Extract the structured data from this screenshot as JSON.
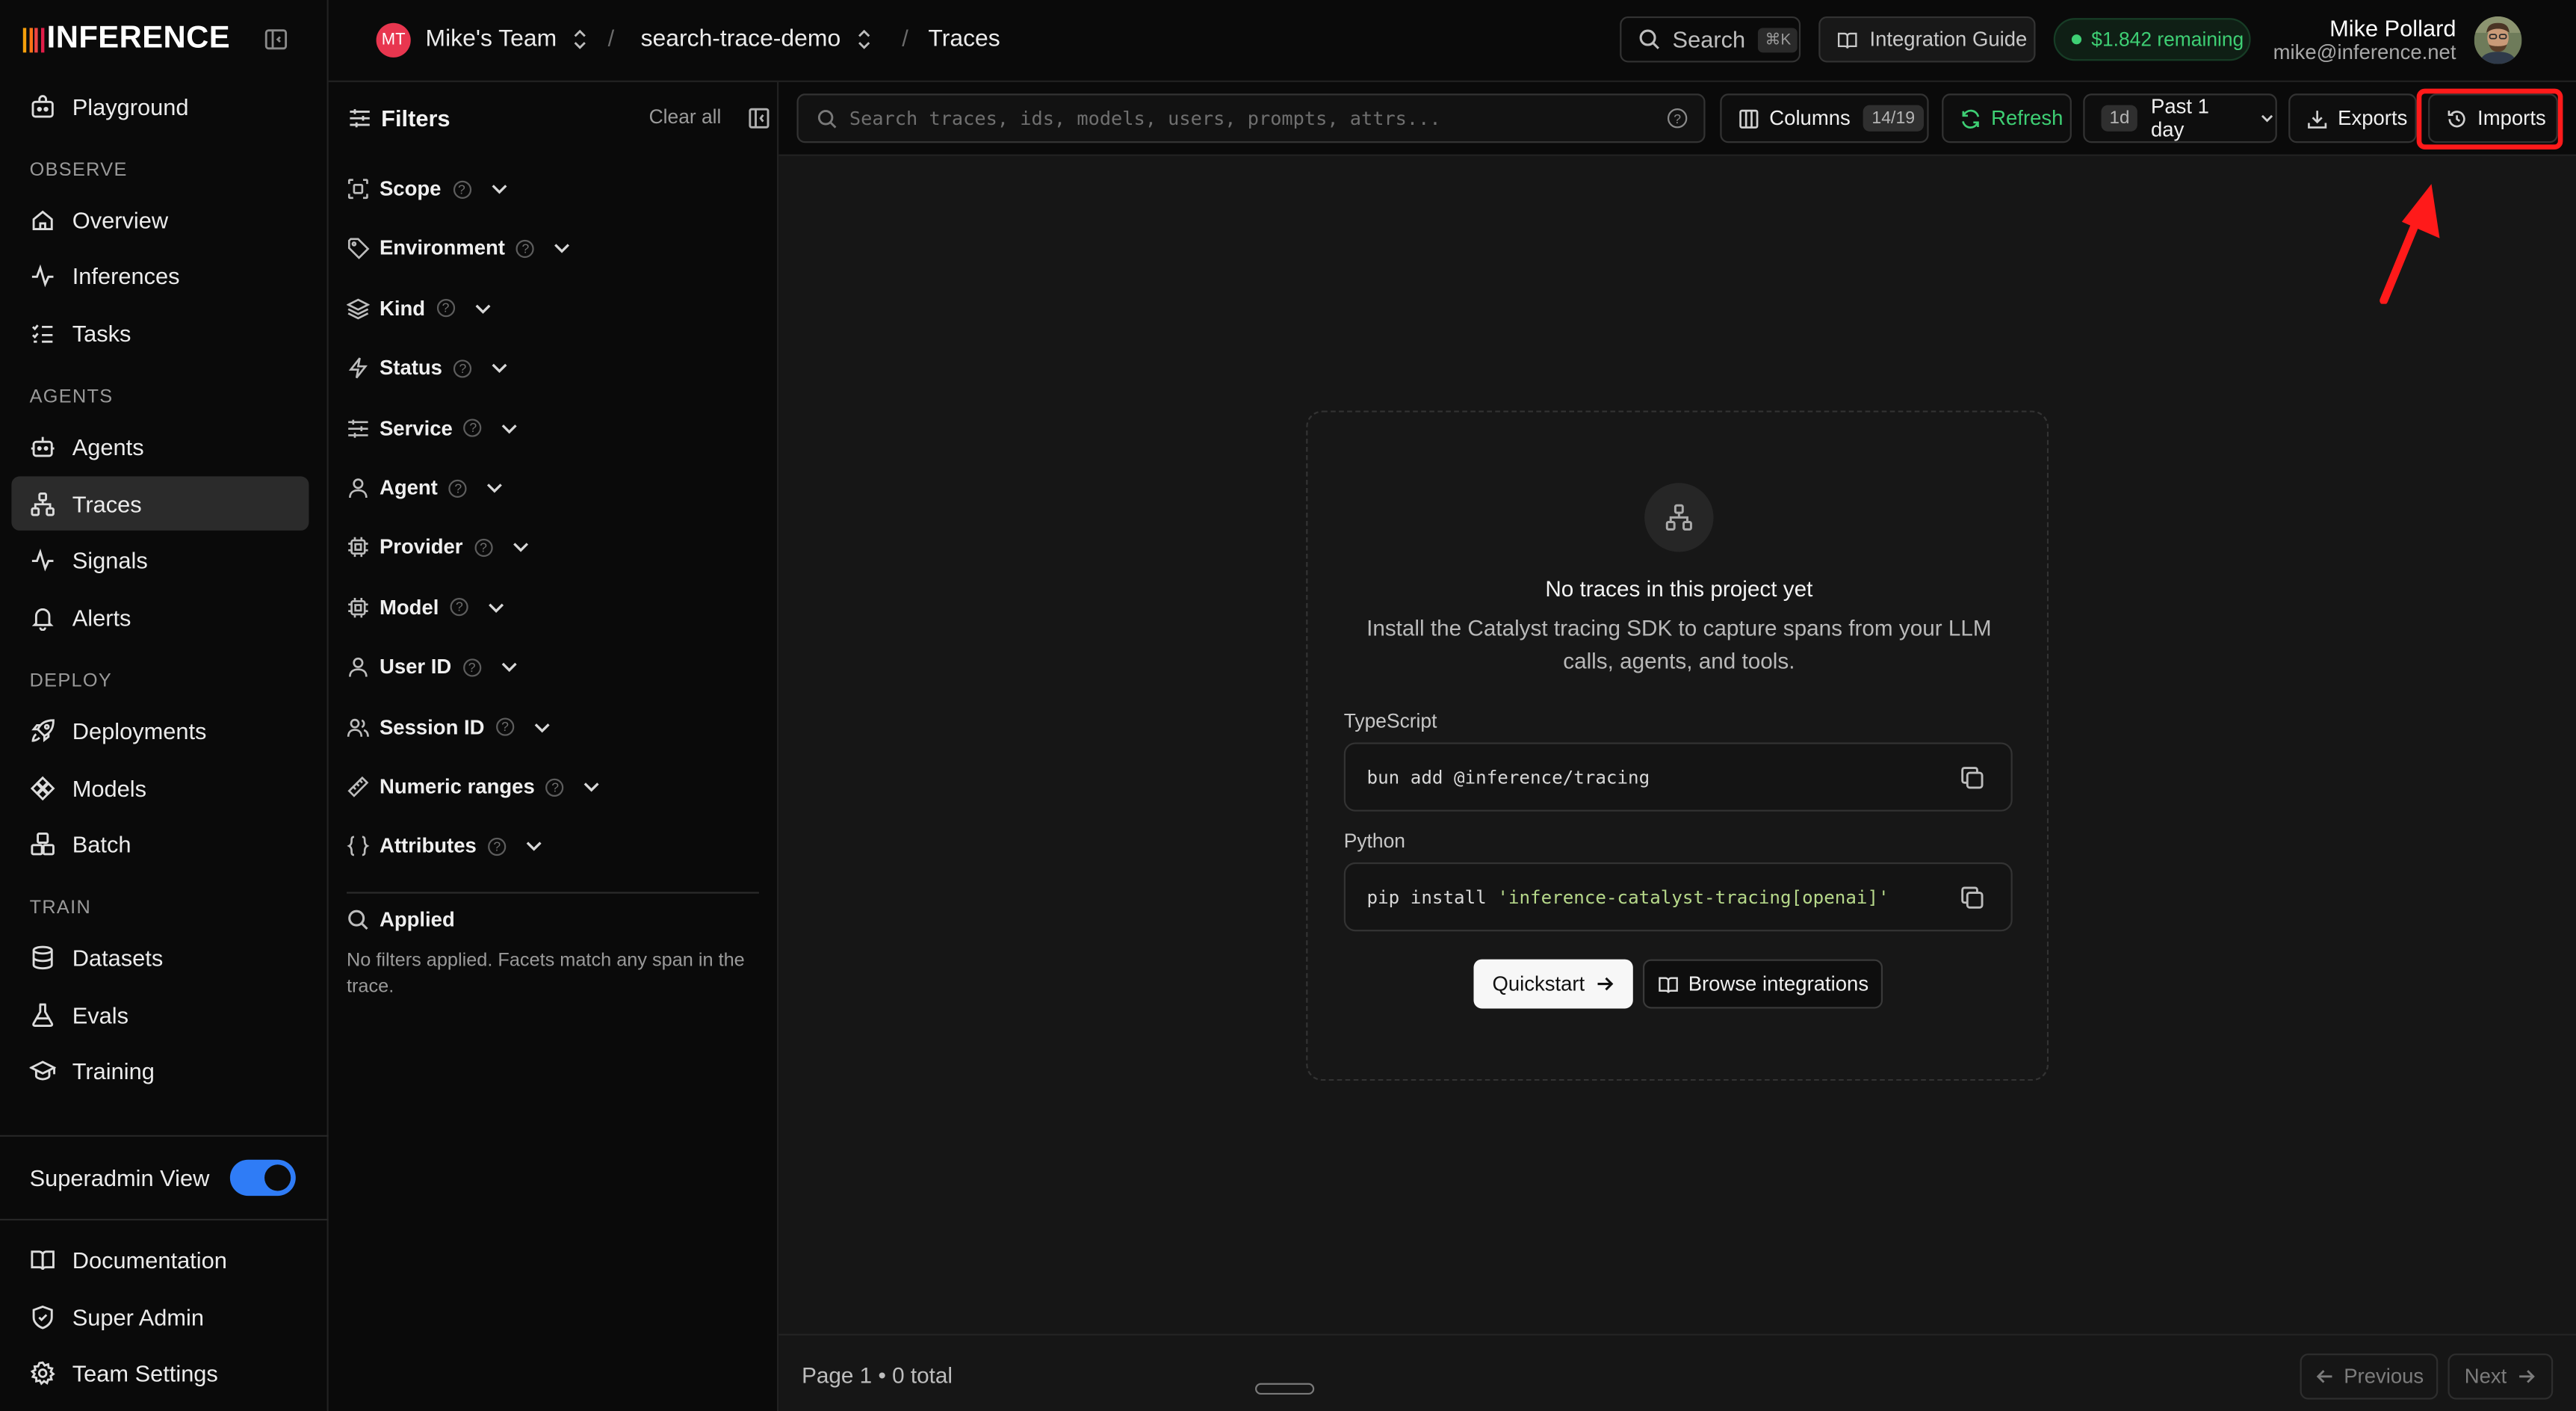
{
  "brand": {
    "name": "INFERENCE",
    "bar_colors": [
      "#f59e0b",
      "#f97316",
      "#ef4444",
      "#e11d48"
    ]
  },
  "sidebar": {
    "playground": "Playground",
    "sections": {
      "observe": "OBSERVE",
      "agents": "AGENTS",
      "deploy": "DEPLOY",
      "train": "TRAIN"
    },
    "observe_items": [
      {
        "label": "Overview",
        "icon": "home-icon"
      },
      {
        "label": "Inferences",
        "icon": "activity-icon"
      },
      {
        "label": "Tasks",
        "icon": "list-checks-icon"
      }
    ],
    "agents_items": [
      {
        "label": "Agents",
        "icon": "bot-icon"
      },
      {
        "label": "Traces",
        "icon": "network-icon",
        "active": true
      },
      {
        "label": "Signals",
        "icon": "activity-icon"
      },
      {
        "label": "Alerts",
        "icon": "bell-icon"
      }
    ],
    "deploy_items": [
      {
        "label": "Deployments",
        "icon": "rocket-icon"
      },
      {
        "label": "Models",
        "icon": "models-icon"
      },
      {
        "label": "Batch",
        "icon": "boxes-icon"
      }
    ],
    "train_items": [
      {
        "label": "Datasets",
        "icon": "database-icon"
      },
      {
        "label": "Evals",
        "icon": "flask-icon"
      },
      {
        "label": "Training",
        "icon": "graduation-cap-icon"
      }
    ],
    "superadmin": {
      "label": "Superadmin View",
      "enabled": true
    },
    "footer_items": [
      {
        "label": "Documentation",
        "icon": "book-icon"
      },
      {
        "label": "Super Admin",
        "icon": "shield-icon"
      },
      {
        "label": "Team Settings",
        "icon": "gear-icon"
      }
    ]
  },
  "topbar": {
    "team_initials": "MT",
    "team": "Mike's Team",
    "project": "search-trace-demo",
    "page": "Traces",
    "search_label": "Search",
    "search_shortcut": "⌘K",
    "guide_label": "Integration Guide",
    "credits": "$1.842 remaining",
    "user_name": "Mike Pollard",
    "user_email": "mike@inference.net"
  },
  "filters": {
    "title": "Filters",
    "clear_all": "Clear all",
    "facets": [
      {
        "label": "Scope",
        "icon": "scan-icon"
      },
      {
        "label": "Environment",
        "icon": "tag-icon"
      },
      {
        "label": "Kind",
        "icon": "layers-icon"
      },
      {
        "label": "Status",
        "icon": "zap-icon"
      },
      {
        "label": "Service",
        "icon": "sliders-icon"
      },
      {
        "label": "Agent",
        "icon": "user-icon"
      },
      {
        "label": "Provider",
        "icon": "chip-icon"
      },
      {
        "label": "Model",
        "icon": "chip-icon"
      },
      {
        "label": "User ID",
        "icon": "user-icon"
      },
      {
        "label": "Session ID",
        "icon": "users-icon"
      },
      {
        "label": "Numeric ranges",
        "icon": "ruler-icon"
      },
      {
        "label": "Attributes",
        "icon": "braces-icon"
      }
    ],
    "applied_title": "Applied",
    "applied_text": "No filters applied. Facets match any span in the trace."
  },
  "toolbar": {
    "search_placeholder": "Search traces, ids, models, users, prompts, attrs...",
    "columns_label": "Columns",
    "columns_count": "14/19",
    "refresh_label": "Refresh",
    "range_tag": "1d",
    "range_label": "Past 1 day",
    "exports_label": "Exports",
    "imports_label": "Imports",
    "highlight_color": "#ff1a1a"
  },
  "empty_state": {
    "title": "No traces in this project yet",
    "subtitle": "Install the Catalyst tracing SDK to capture spans from your LLM calls, agents, and tools.",
    "ts_label": "TypeScript",
    "ts_command": "bun add @inference/tracing",
    "py_label": "Python",
    "py_command_prefix": "pip install ",
    "py_command_arg": "'inference-catalyst-tracing[openai]'",
    "quickstart_label": "Quickstart",
    "browse_label": "Browse integrations"
  },
  "footer": {
    "page_info": "Page 1 • 0 total",
    "previous": "Previous",
    "next": "Next"
  }
}
